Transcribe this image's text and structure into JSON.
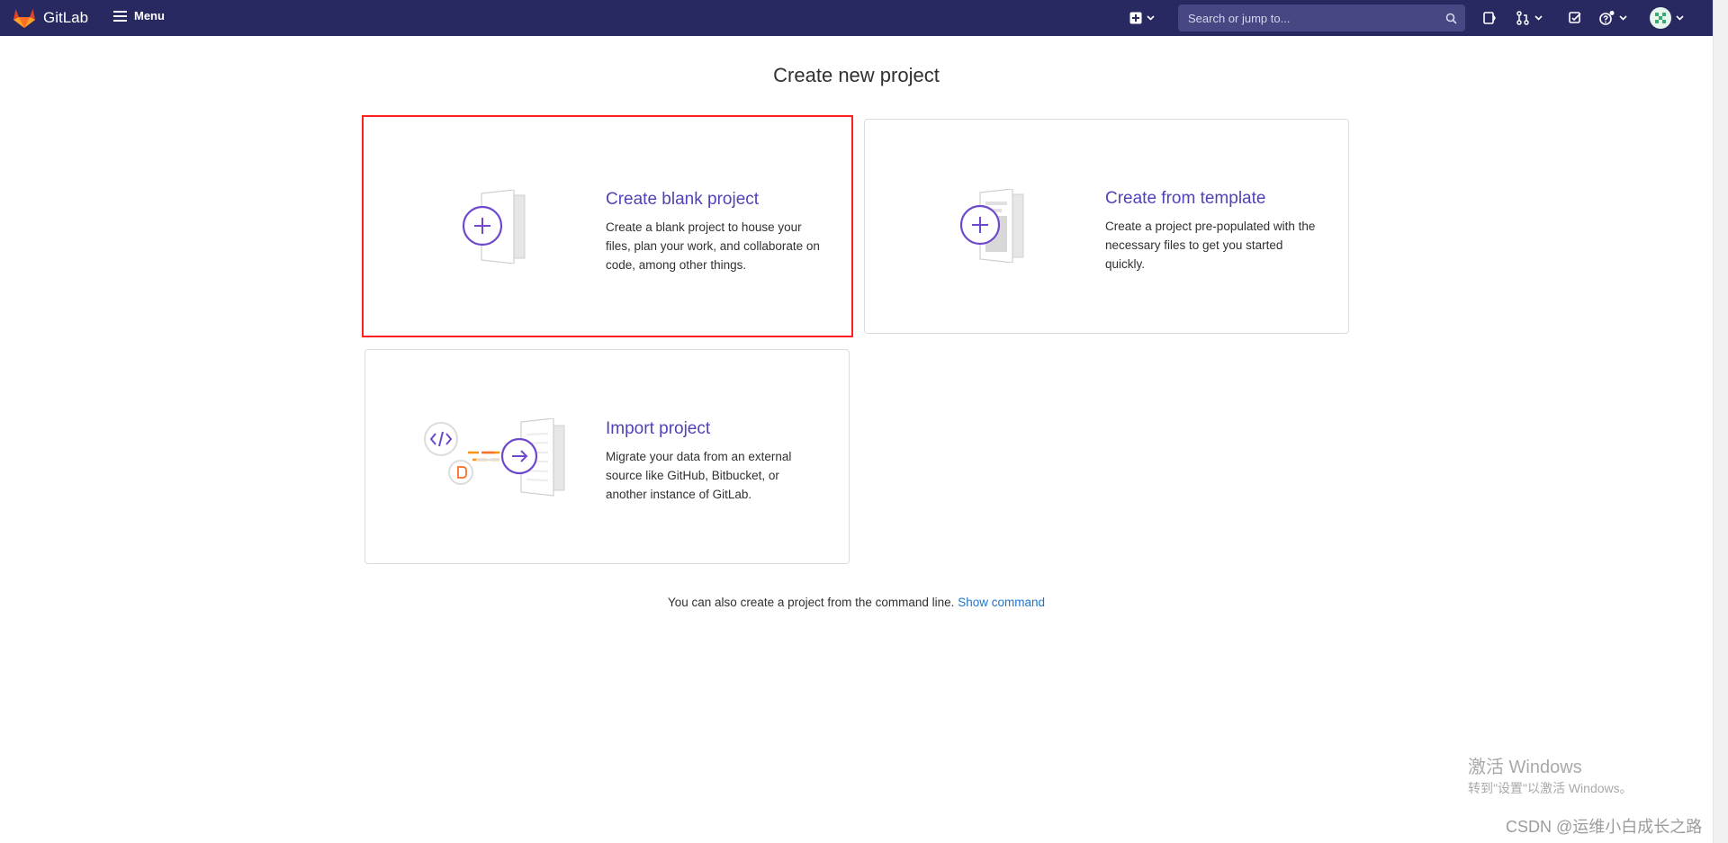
{
  "navbar": {
    "brand": "GitLab",
    "menu_label": "Menu",
    "search": {
      "placeholder": "Search or jump to..."
    },
    "colors": {
      "background": "#292961",
      "search_bg": "#474784"
    },
    "icons": [
      "plus-square-icon",
      "search-icon",
      "code-review-icon",
      "merge-request-icon",
      "todo-icon",
      "help-icon",
      "avatar"
    ]
  },
  "main": {
    "title": "Create new project",
    "cards": [
      {
        "title": "Create blank project",
        "description": "Create a blank project to house your files, plan your work, and collaborate on code, among other things.",
        "selected": true
      },
      {
        "title": "Create from template",
        "description": "Create a project pre-populated with the necessary files to get you started quickly.",
        "selected": false
      },
      {
        "title": "Import project",
        "description": "Migrate your data from an external source like GitHub, Bitbucket, or another instance of GitLab.",
        "selected": false
      }
    ],
    "command_line": {
      "text": "You can also create a project from the command line.",
      "link": "Show command"
    }
  },
  "watermark": {
    "windows_line1": "激活 Windows",
    "windows_line2": "转到\"设置\"以激活 Windows。",
    "csdn": "CSDN @运维小白成长之路"
  },
  "colors": {
    "accent": "#5043b8",
    "link": "#1f75cb",
    "selection_border": "#ff2020"
  }
}
